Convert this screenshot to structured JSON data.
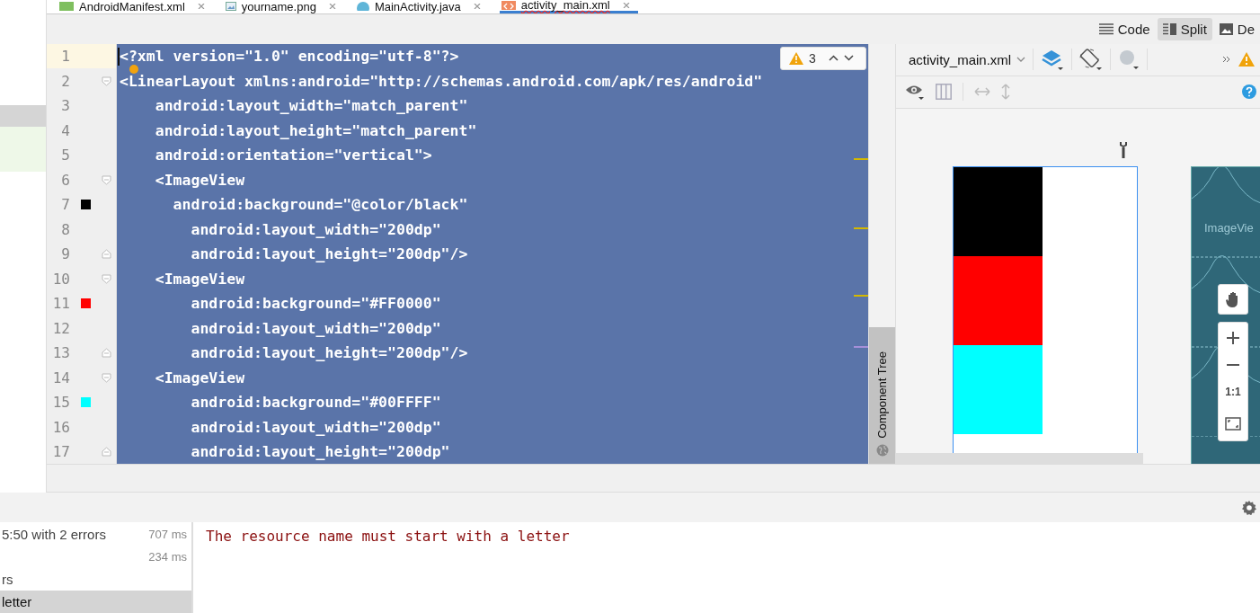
{
  "file_tabs": [
    {
      "label": "AndroidManifest.xml",
      "kind": "manifest",
      "selected": false
    },
    {
      "label": "yourname.png",
      "kind": "image",
      "selected": false
    },
    {
      "label": "MainActivity.java",
      "kind": "class",
      "selected": false
    },
    {
      "label": "activity_main.xml",
      "kind": "layout",
      "selected": true
    }
  ],
  "view_modes": [
    {
      "label": "Code",
      "kind": "code",
      "selected": false
    },
    {
      "label": "Split",
      "kind": "split",
      "selected": true
    },
    {
      "label": "De",
      "kind": "design",
      "selected": false
    }
  ],
  "editor": {
    "warning_count": "3",
    "lines": [
      {
        "number": "1",
        "text": "<?xml version=\"1.0\" encoding=\"utf-8\"?>",
        "current": true
      },
      {
        "number": "2",
        "text": "<LinearLayout xmlns:android=\"http://schemas.android.com/apk/res/android\"",
        "current": false,
        "kind": "opener"
      },
      {
        "number": "3",
        "text": "    android:layout_width=\"match_parent\"",
        "current": false
      },
      {
        "number": "4",
        "text": "    android:layout_height=\"match_parent\"",
        "current": false
      },
      {
        "number": "5",
        "text": "    android:orientation=\"vertical\">",
        "current": false
      },
      {
        "number": "6",
        "text": "    <ImageView",
        "current": false,
        "kind": "opener"
      },
      {
        "number": "7",
        "text": "      android:background=\"@color/black\"",
        "current": false,
        "color": "#000000"
      },
      {
        "number": "8",
        "text": "        android:layout_width=\"200dp\"",
        "current": false
      },
      {
        "number": "9",
        "text": "        android:layout_height=\"200dp\"/>",
        "current": false,
        "kind": "closer"
      },
      {
        "number": "10",
        "text": "    <ImageView",
        "current": false,
        "kind": "opener"
      },
      {
        "number": "11",
        "text": "        android:background=\"#FF0000\"",
        "current": false,
        "color": "#ff0000"
      },
      {
        "number": "12",
        "text": "        android:layout_width=\"200dp\"",
        "current": false
      },
      {
        "number": "13",
        "text": "        android:layout_height=\"200dp\"/>",
        "current": false,
        "kind": "closer"
      },
      {
        "number": "14",
        "text": "    <ImageView",
        "current": false,
        "kind": "opener"
      },
      {
        "number": "15",
        "text": "        android:background=\"#00FFFF\"",
        "current": false,
        "color": "#00ffff"
      },
      {
        "number": "16",
        "text": "        android:layout_width=\"200dp\"",
        "current": false
      },
      {
        "number": "17",
        "text": "        android:layout_height=\"200dp\"",
        "current": false,
        "kind": "closer"
      }
    ]
  },
  "component_tree": {
    "label": "Component Tree"
  },
  "design": {
    "file": "activity_main.xml",
    "blueprint_label": "ImageVie",
    "zoom_reset": "1:1"
  },
  "build": {
    "rows": [
      {
        "label": "5:50 with 2 errors",
        "time": "707 ms",
        "selected": false
      },
      {
        "time": "234 ms",
        "selected": false
      },
      {
        "label": "rs",
        "selected": false
      },
      {
        "label": "letter",
        "selected": true
      }
    ],
    "output": "The resource name must start with a letter"
  }
}
